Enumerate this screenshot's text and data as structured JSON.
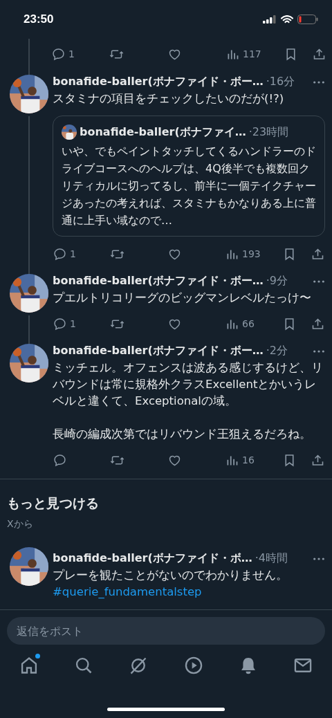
{
  "status_bar": {
    "time": "23:50"
  },
  "top_actions": {
    "replies": "1",
    "views": "117"
  },
  "posts": [
    {
      "name": "bonafide-baller(ボナファイド・ボー…",
      "time": "·16分",
      "paragraphs": [
        "スタミナの項目をチェックしたいのだが(!?)"
      ],
      "thread_above": true,
      "thread_below": true,
      "quote": {
        "name": "bonafide-baller(ボナファイ…",
        "time": "·23時間",
        "text": "いや、でもペイントタッチしてくるハンドラーのドライブコースへのヘルプは、4Q後半でも複数回クリティカルに切ってるし、前半に一個テイクチャージあったの考えれば、スタミナもかなりある上に普通に上手い域なので…"
      },
      "replies": "1",
      "views": "193"
    },
    {
      "name": "bonafide-baller(ボナファイド・ボー…",
      "time": "·9分",
      "paragraphs": [
        "プエルトリコリーグのビッグマンレベルたっけ〜"
      ],
      "thread_above": true,
      "thread_below": true,
      "replies": "1",
      "views": "66"
    },
    {
      "name": "bonafide-baller(ボナファイド・ボー…",
      "time": "·2分",
      "paragraphs": [
        "ミッチェル。オフェンスは波ある感じするけど、リバウンドは常に規格外クラスExcellentとかいうレベルと違くて、Exceptionalの域。",
        "長崎の編成次第ではリバウンド王狙えるだろね。"
      ],
      "thread_above": true,
      "thread_below": false,
      "views": "16"
    }
  ],
  "section": {
    "title": "もっと見つける",
    "subtitle": "Xから"
  },
  "recommended": {
    "name": "bonafide-baller(ボナファイド・ボ…",
    "time": "·4時間",
    "text": "プレーを観たことがないのでわかりません。",
    "hashtag": "#querie_fundamentalstep"
  },
  "reply_field": {
    "placeholder": "返信をポスト"
  },
  "nav": [
    {
      "kind": "home",
      "badge": true
    },
    {
      "kind": "search",
      "badge": false
    },
    {
      "kind": "grok",
      "badge": false
    },
    {
      "kind": "video",
      "badge": false
    },
    {
      "kind": "notifications",
      "badge": false
    },
    {
      "kind": "messages",
      "badge": false
    }
  ]
}
